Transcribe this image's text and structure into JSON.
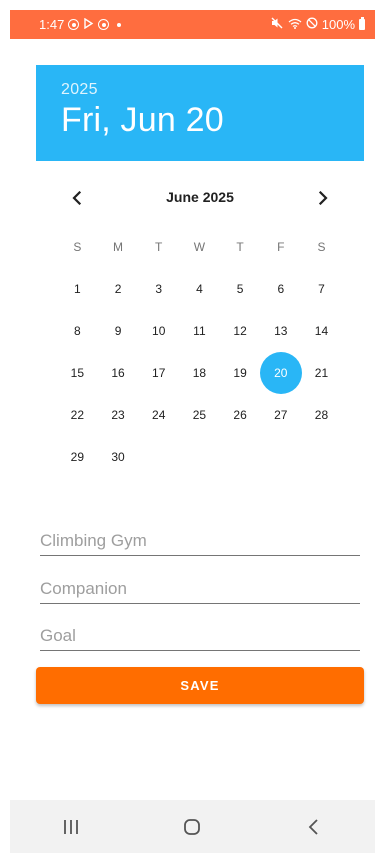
{
  "status_bar": {
    "time": "1:47",
    "battery": "100%",
    "color": "#ff6d3f"
  },
  "header": {
    "year": "2025",
    "selected_date": "Fri, Jun 20",
    "color": "#29b6f6"
  },
  "calendar": {
    "month_title": "June 2025",
    "weekdays": [
      "S",
      "M",
      "T",
      "W",
      "T",
      "F",
      "S"
    ],
    "leading_blanks": 0,
    "days": [
      "1",
      "2",
      "3",
      "4",
      "5",
      "6",
      "7",
      "8",
      "9",
      "10",
      "11",
      "12",
      "13",
      "14",
      "15",
      "16",
      "17",
      "18",
      "19",
      "20",
      "21",
      "22",
      "23",
      "24",
      "25",
      "26",
      "27",
      "28",
      "29",
      "30"
    ],
    "selected_day": "20",
    "prev_icon": "chevron-left-icon",
    "next_icon": "chevron-right-icon"
  },
  "form": {
    "climbing_gym": {
      "value": "",
      "placeholder": "Climbing Gym"
    },
    "companion": {
      "value": "",
      "placeholder": "Companion"
    },
    "goal": {
      "value": "",
      "placeholder": "Goal"
    },
    "save_label": "SAVE",
    "save_color": "#ff6d00"
  },
  "nav_bar": {
    "icons": [
      "recents-icon",
      "home-icon",
      "back-icon"
    ]
  }
}
